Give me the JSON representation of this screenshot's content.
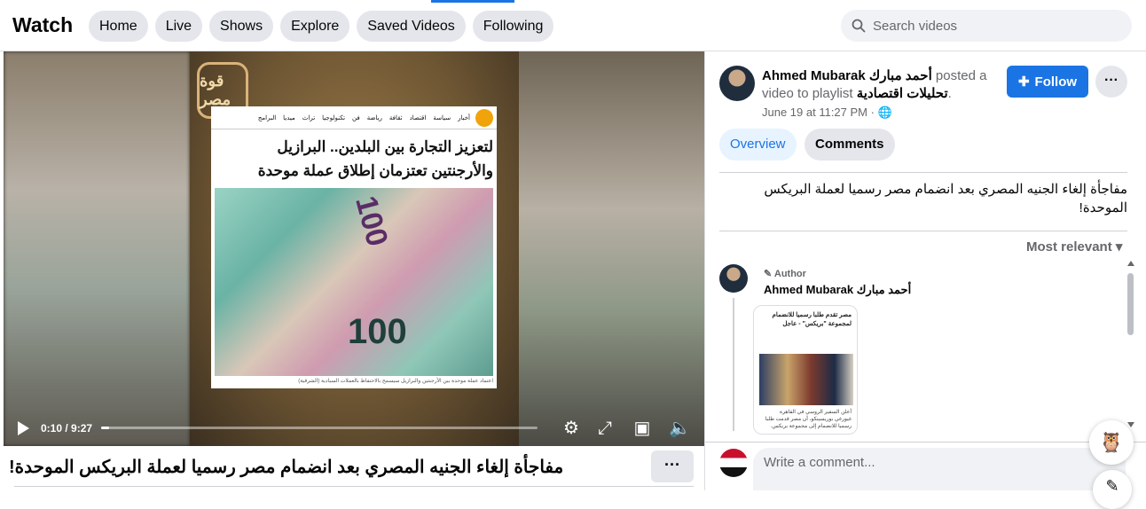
{
  "header": {
    "brand": "Watch",
    "nav": [
      "Home",
      "Live",
      "Shows",
      "Explore",
      "Saved Videos",
      "Following"
    ],
    "search_placeholder": "Search videos"
  },
  "video": {
    "card_nav": [
      "أخبار",
      "سياسة",
      "اقتصاد",
      "ثقافة",
      "رياضة",
      "فن",
      "تكنولوجيا",
      "تراث",
      "ميديا",
      "البرامج"
    ],
    "card_headline": "لتعزيز التجارة بين البلدين.. البرازيل والأرجنتين تعتزمان إطلاق عملة موحدة",
    "logo_text": "قوة مصر",
    "banknote_value_1": "100",
    "banknote_value_2": "100",
    "card_caption": "اعتماد عملة موحدة بين الأرجنتين والبرازيل سيسمح بالاحتفاظ بالعملات السيادية (الشرقية)",
    "current_time": "0:10",
    "duration": "9:27",
    "progress": 0.018,
    "title": "مفاجأة إلغاء الجنيه المصري بعد انضمام مصر رسميا لعملة البريكس الموحدة!"
  },
  "post": {
    "author": "Ahmed Mubarak أحمد مبارك",
    "posted_text": " posted a video to playlist ",
    "playlist": "تحليلات اقتصادية",
    "playlist_suffix": ".",
    "timestamp": "June 19 at 11:27 PM · ",
    "follow_label": "Follow",
    "tabs": [
      "Overview",
      "Comments"
    ],
    "description": "مفاجأة إلغاء الجنيه المصري بعد انضمام مصر رسميا لعملة البريكس الموحدة!",
    "sort_label": "Most relevant"
  },
  "comment": {
    "badge": "Author",
    "name": "Ahmed Mubarak أحمد مبارك",
    "image_headline": "مصر تقدم طلبا رسميا للانضمام لمجموعة \"بريكس\" - عاجل",
    "image_caption": "أعلن السفير الروسي في القاهرة غيورغي بوريسينكو، أن مصر قدمت طلبا رسميا للانضمام إلى مجموعة بريكس."
  },
  "composer": {
    "placeholder": "Write a comment..."
  },
  "colors": {
    "accent": "#1b74e4",
    "pill_bg": "#e4e6eb"
  }
}
